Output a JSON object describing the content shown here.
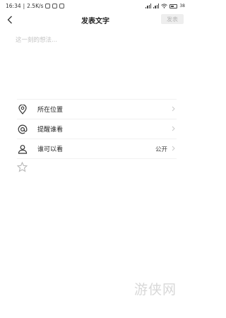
{
  "statusbar": {
    "time": "16:34",
    "net_speed": "2.5K/s",
    "battery": "38"
  },
  "header": {
    "title": "发表文字",
    "publish_label": "发表"
  },
  "composer": {
    "placeholder": "这一刻的想法..."
  },
  "options": [
    {
      "label": "所在位置",
      "icon": "location-pin-icon"
    },
    {
      "label": "提醒谁看",
      "icon": "at-sign-icon"
    },
    {
      "label": "谁可以看",
      "icon": "user-icon",
      "value": "公开"
    }
  ],
  "extras": {
    "star_icon": "star-outline-icon"
  },
  "watermark": "游侠网"
}
